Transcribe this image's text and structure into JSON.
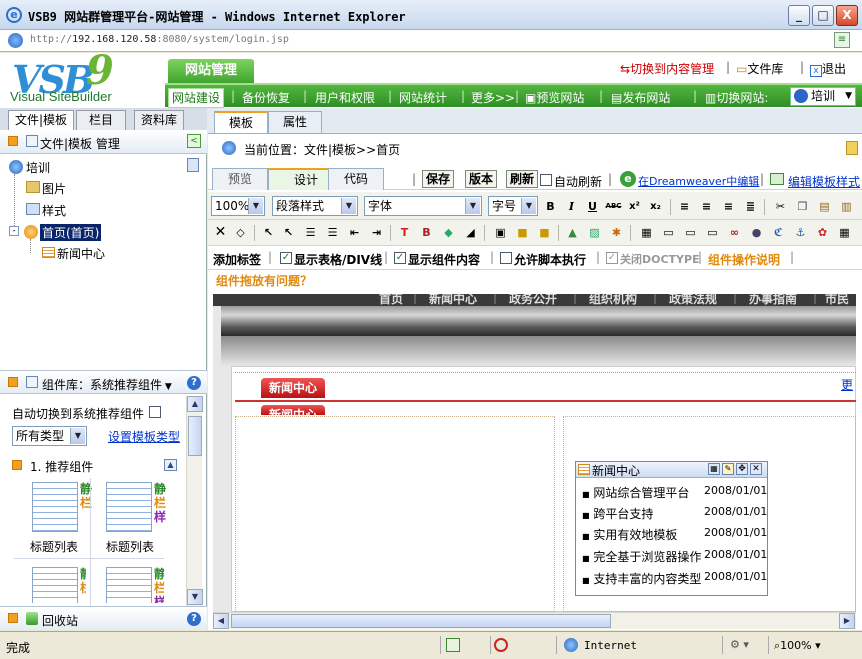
{
  "window": {
    "title": "VSB9 网站群管理平台-网站管理 - Windows Internet Explorer",
    "min": "_",
    "max": "□",
    "close": "X"
  },
  "address": {
    "url_gray": "http://",
    "url_host": "192.168.120.58",
    "url_rest": ":8080/system/login.jsp"
  },
  "header": {
    "logo_text": "VSB",
    "logo_nine": "9",
    "logo_sub": "Visual SiteBuilder",
    "main_tab": "网站管理",
    "switch_content": "切换到内容管理",
    "file_lib": "文件库",
    "logout": "退出",
    "nav": [
      "网站建设",
      "备份恢复",
      "用户和权限",
      "网站统计",
      "更多>>"
    ],
    "preview": "预览网站",
    "publish": "发布网站",
    "switch_site": "切换网站:",
    "site_value": "培训"
  },
  "left": {
    "tabs": [
      "文件|模板",
      "栏目",
      "资料库"
    ],
    "head": "文件|模板 管理",
    "tree": {
      "root": "培训",
      "images": "图片",
      "styles": "样式",
      "home": "首页(首页)",
      "news": "新闻中心"
    },
    "comp_head": "组件库：系统推荐组件",
    "auto_switch": "自动切换到系统推荐组件",
    "type_value": "所有类型",
    "set_type": "设置模板类型",
    "section": "1. 推荐组件",
    "cards": [
      {
        "label": "标题列表",
        "tag1": "静",
        "tag2": "栏"
      },
      {
        "label": "标题列表",
        "tag1": "静",
        "tag2": "栏",
        "tag3": "样"
      },
      {
        "label": "",
        "tag1": "静",
        "tag2": "栏"
      },
      {
        "label": "",
        "tag1": "静",
        "tag2": "栏",
        "tag3": "样"
      }
    ],
    "recycle": "回收站"
  },
  "right": {
    "tabs": [
      "模板",
      "属性"
    ],
    "location": "当前位置：文件|模板>>首页",
    "view_tabs": [
      "预览",
      "设计",
      "代码"
    ],
    "save": "保存",
    "version": "版本",
    "refresh": "刷新",
    "auto_refresh": "自动刷新",
    "dreamweaver": "在Dreamweaver中编辑",
    "edit_style": "编辑模板样式",
    "zoom": "100%",
    "para_style": "段落样式",
    "font": "字体",
    "font_size": "字号",
    "tools_b": "B",
    "tools_i": "I",
    "tools_u": "U",
    "tools_abc": "ABC",
    "tools_sup": "x²",
    "tools_sub": "x₂",
    "add_tag": "添加标签",
    "show_table": "显示表格/DIV线",
    "show_comp": "显示组件内容",
    "allow_script": "允许脚本执行",
    "close_doctype": "关闭DOCTYPE",
    "comp_help": "组件操作说明",
    "drag_issue": "组件拖放有问题？"
  },
  "canvas": {
    "menu": [
      "首页",
      "新闻中心",
      "政务公开",
      "组织机构",
      "政策法规",
      "办事指南",
      "市民"
    ],
    "news_tab": "新闻中心",
    "news_tab2": "新闻中心",
    "more": "更",
    "widget_title": "新闻中心",
    "items": [
      {
        "title": "网站综合管理平台",
        "date": "2008/01/01"
      },
      {
        "title": "跨平台支持",
        "date": "2008/01/01"
      },
      {
        "title": "实用有效地模板",
        "date": "2008/01/01"
      },
      {
        "title": "完全基于浏览器操作",
        "date": "2008/01/01"
      },
      {
        "title": "支持丰富的内容类型",
        "date": "2008/01/01"
      }
    ]
  },
  "status": {
    "done": "完成",
    "zone": "Internet",
    "zoom": "100%"
  }
}
